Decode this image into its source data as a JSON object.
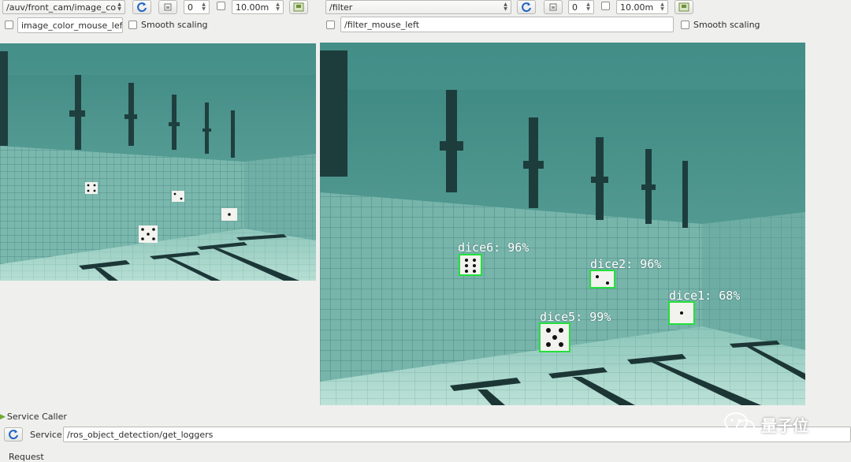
{
  "left_toolbar": {
    "topic": "/auv/front_cam/image_colo",
    "spin_value": "0",
    "interval": "10.00m",
    "mouse_topic": "image_color_mouse_left",
    "smooth_label": "Smooth scaling"
  },
  "right_toolbar": {
    "topic": "/filter",
    "spin_value": "0",
    "interval": "10.00m",
    "mouse_topic": "/filter_mouse_left",
    "smooth_label": "Smooth scaling"
  },
  "detections": [
    {
      "label": "dice6: 96%",
      "pips": 6
    },
    {
      "label": "dice2: 96%",
      "pips": 2
    },
    {
      "label": "dice1: 68%",
      "pips": 1
    },
    {
      "label": "dice5: 99%",
      "pips": 5
    }
  ],
  "service_caller": {
    "title": "Service Caller",
    "service_label": "Service",
    "service_value": "/ros_object_detection/get_loggers",
    "request_label": "Request"
  },
  "watermark": {
    "text": "量子位"
  },
  "colors": {
    "detection_box": "#23e03a",
    "water": "#7fb8ad",
    "panel_bg": "#efefee",
    "refresh_icon": "#1f63c4"
  }
}
